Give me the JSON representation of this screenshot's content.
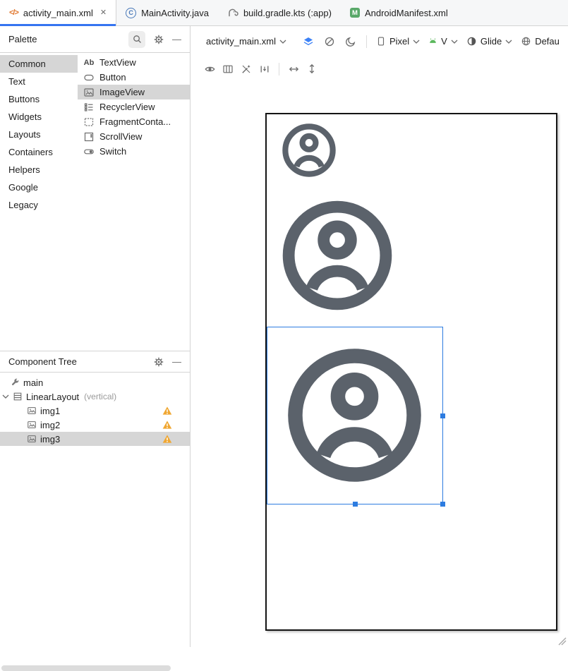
{
  "icons": {
    "close": "✕",
    "minimize": "—",
    "xml_tag": "</>",
    "class_letter": "C",
    "manifest_letter": "M",
    "textview_glyph": "Ab"
  },
  "tabs": [
    {
      "label": "activity_main.xml"
    },
    {
      "label": "MainActivity.java"
    },
    {
      "label": "build.gradle.kts (:app)"
    },
    {
      "label": "AndroidManifest.xml"
    }
  ],
  "palette": {
    "title": "Palette",
    "categories": [
      "Common",
      "Text",
      "Buttons",
      "Widgets",
      "Layouts",
      "Containers",
      "Helpers",
      "Google",
      "Legacy"
    ],
    "selected_category": "Common",
    "components": [
      {
        "label": "TextView"
      },
      {
        "label": "Button"
      },
      {
        "label": "ImageView"
      },
      {
        "label": "RecyclerView"
      },
      {
        "label": "FragmentConta..."
      },
      {
        "label": "ScrollView"
      },
      {
        "label": "Switch"
      }
    ],
    "selected_component": "ImageView"
  },
  "component_tree": {
    "title": "Component Tree",
    "items": [
      {
        "label": "main"
      },
      {
        "label": "LinearLayout",
        "suffix": "(vertical)"
      },
      {
        "label": "img1"
      },
      {
        "label": "img2"
      },
      {
        "label": "img3"
      }
    ],
    "selected_item": "img3"
  },
  "design_toolbar": {
    "file": "activity_main.xml",
    "device": "Pixel",
    "api": "V",
    "theme": "Glide",
    "locale": "Defau"
  },
  "colors": {
    "accent_blue": "#3574f0",
    "selection_blue": "#2d7ce0",
    "warning_orange": "#f0a732",
    "avatar_gray": "#5b626b"
  }
}
